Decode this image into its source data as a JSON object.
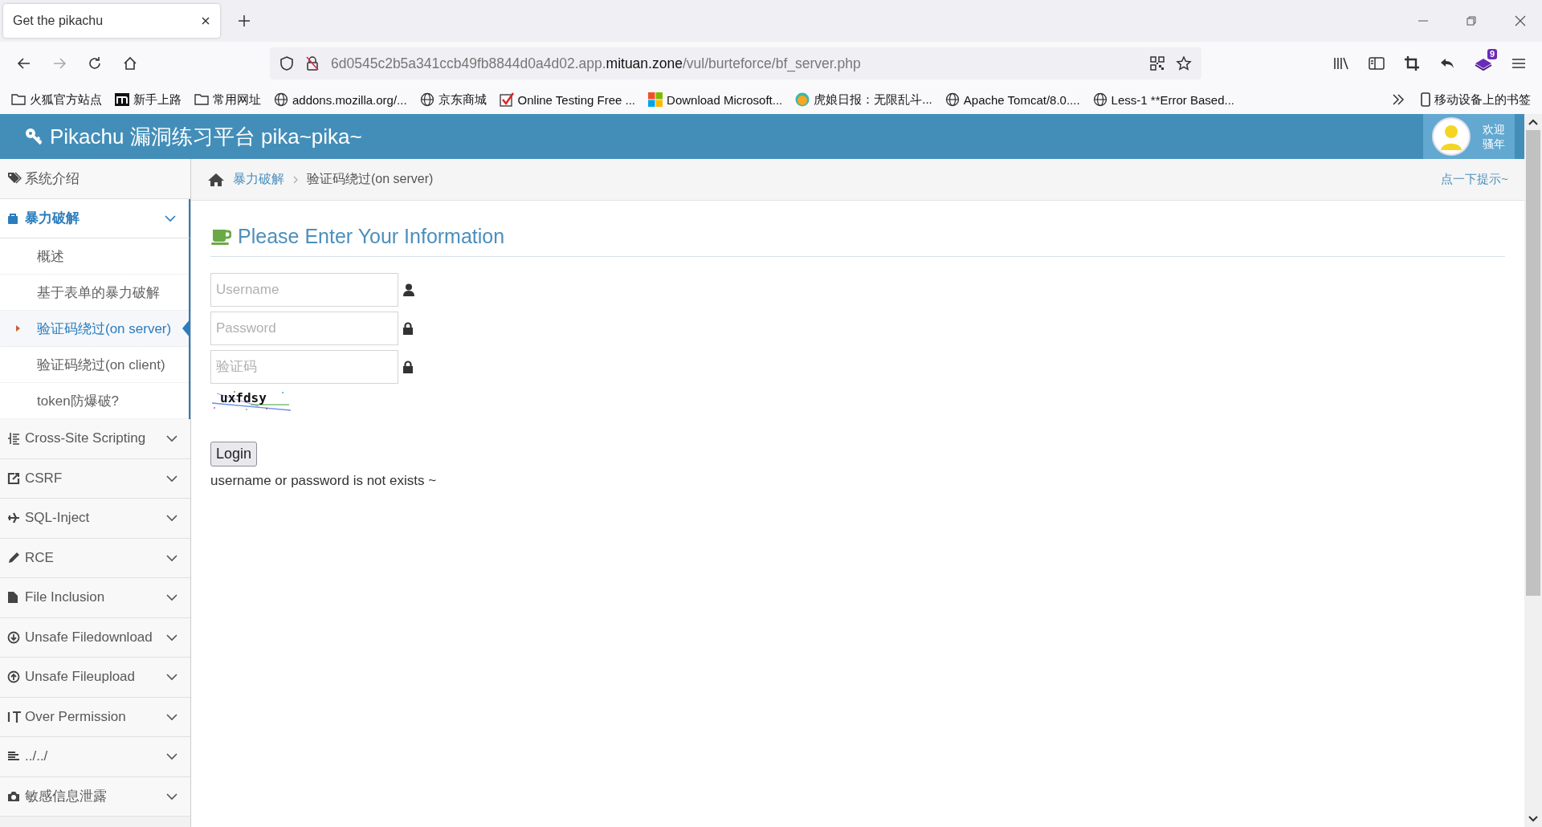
{
  "browser": {
    "tab_title": "Get the pikachu",
    "url": {
      "prefix": "6d0545c2b5a341ccb49fb8844d0a4d02.app.",
      "domain": "mituan.zone",
      "path": "/vul/burteforce/bf_server.php"
    },
    "extension_badge": "9",
    "bookmarks": [
      {
        "label": "火狐官方站点",
        "kind": "folder"
      },
      {
        "label": "新手上路",
        "kind": "m"
      },
      {
        "label": "常用网址",
        "kind": "folder"
      },
      {
        "label": "addons.mozilla.org/...",
        "kind": "globe"
      },
      {
        "label": "京东商城",
        "kind": "globe"
      },
      {
        "label": "Online Testing Free ...",
        "kind": "check"
      },
      {
        "label": "Download Microsoft...",
        "kind": "windows"
      },
      {
        "label": "虎娘日报：无限乱斗...",
        "kind": "tiger"
      },
      {
        "label": "Apache Tomcat/8.0....",
        "kind": "globe"
      },
      {
        "label": "Less-1 **Error Based...",
        "kind": "globe"
      }
    ],
    "mobile_bookmarks": "移动设备上的书签"
  },
  "app_header": {
    "title": "Pikachu 漏洞练习平台 pika~pika~",
    "greeting": [
      "欢迎",
      "骚年"
    ]
  },
  "sidebar": {
    "items": [
      {
        "label": "系统介绍",
        "kind": "tag",
        "selected": false
      },
      {
        "label": "暴力破解",
        "kind": "lock",
        "selected": true,
        "children": [
          {
            "label": "概述",
            "selected": false
          },
          {
            "label": "基于表单的暴力破解",
            "selected": false
          },
          {
            "label": "验证码绕过(on server)",
            "selected": true
          },
          {
            "label": "验证码绕过(on client)",
            "selected": false
          },
          {
            "label": "token防爆破?",
            "selected": false
          }
        ]
      },
      {
        "label": "Cross-Site Scripting",
        "kind": "xss",
        "selected": false
      },
      {
        "label": "CSRF",
        "kind": "share",
        "selected": false
      },
      {
        "label": "SQL-Inject",
        "kind": "plane",
        "selected": false
      },
      {
        "label": "RCE",
        "kind": "pencil",
        "selected": false
      },
      {
        "label": "File Inclusion",
        "kind": "file",
        "selected": false
      },
      {
        "label": "Unsafe Filedownload",
        "kind": "download",
        "selected": false
      },
      {
        "label": "Unsafe Fileupload",
        "kind": "upload",
        "selected": false
      },
      {
        "label": "Over Permission",
        "kind": "text",
        "selected": false
      },
      {
        "label": "../../",
        "kind": "list",
        "selected": false
      },
      {
        "label": "敏感信息泄露",
        "kind": "camera",
        "selected": false
      }
    ]
  },
  "breadcrumb": [
    "暴力破解",
    "验证码绕过(on server)"
  ],
  "hint_link": "点一下提示~",
  "form": {
    "title": "Please Enter Your Information",
    "fields": [
      {
        "placeholder": "Username",
        "kind": "user"
      },
      {
        "placeholder": "Password",
        "kind": "lock"
      },
      {
        "placeholder": "验证码",
        "kind": "lock"
      }
    ],
    "captcha": "uxfdsy",
    "button": "Login",
    "message": "username or password is not exists ~"
  }
}
